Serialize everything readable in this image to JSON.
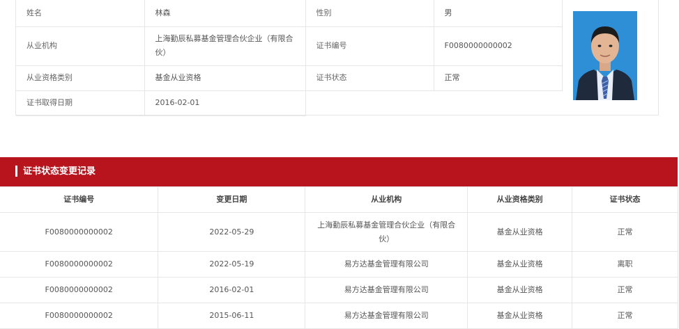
{
  "profile": {
    "name_label": "姓名",
    "name_value": "林森",
    "gender_label": "性别",
    "gender_value": "男",
    "org_label": "从业机构",
    "org_value": "上海勤辰私募基金管理合伙企业（有限合伙）",
    "cert_no_label": "证书编号",
    "cert_no_value": "F0080000000002",
    "qual_label": "从业资格类别",
    "qual_value": "基金从业资格",
    "status_label": "证书状态",
    "status_value": "正常",
    "date_label": "证书取得日期",
    "date_value": "2016-02-01"
  },
  "section": {
    "title": "证书状态变更记录"
  },
  "records": {
    "headers": [
      "证书编号",
      "变更日期",
      "从业机构",
      "从业资格类别",
      "证书状态"
    ],
    "rows": [
      [
        "F0080000000002",
        "2022-05-29",
        "上海勤辰私募基金管理合伙企业（有限合伙）",
        "基金从业资格",
        "正常"
      ],
      [
        "F0080000000002",
        "2022-05-19",
        "易方达基金管理有限公司",
        "基金从业资格",
        "离职"
      ],
      [
        "F0080000000002",
        "2016-02-01",
        "易方达基金管理有限公司",
        "基金从业资格",
        "正常"
      ],
      [
        "F0080000000002",
        "2015-06-11",
        "易方达基金管理有限公司",
        "基金从业资格",
        "正常"
      ]
    ]
  },
  "colors": {
    "header_red": "#b8141e",
    "border": "#e6e6e6",
    "photo_background": "#2f8fd6"
  },
  "icons": {
    "photo": "person-portrait"
  }
}
